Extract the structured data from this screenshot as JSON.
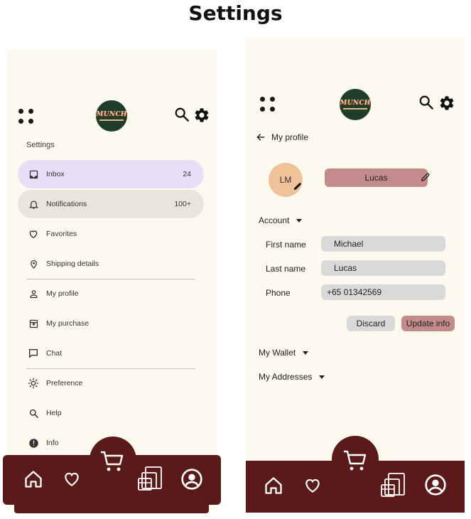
{
  "page_title": "Settings",
  "left": {
    "menu_heading": "Settings",
    "menu": [
      {
        "id": "inbox",
        "label": "Inbox",
        "badge": "24",
        "icon": "inbox-icon"
      },
      {
        "id": "notifications",
        "label": "Notifications",
        "badge": "100+",
        "icon": "bell-icon"
      },
      {
        "id": "favorites",
        "label": "Favorites",
        "badge": "",
        "icon": "heart-icon"
      },
      {
        "id": "shipping",
        "label": "Shipping details",
        "badge": "",
        "icon": "location-pin-icon"
      },
      {
        "id": "profile",
        "label": "My profile",
        "badge": "",
        "icon": "person-icon"
      },
      {
        "id": "purchase",
        "label": "My purchase",
        "badge": "",
        "icon": "download-box-icon"
      },
      {
        "id": "chat",
        "label": "Chat",
        "badge": "",
        "icon": "chat-icon"
      },
      {
        "id": "preference",
        "label": "Preference",
        "badge": "",
        "icon": "sun-icon"
      },
      {
        "id": "help",
        "label": "Help",
        "badge": "",
        "icon": "search-icon"
      },
      {
        "id": "info",
        "label": "Info",
        "badge": "",
        "icon": "info-icon"
      }
    ]
  },
  "brand": {
    "logo_text": "MUNCH"
  },
  "right": {
    "back_label": "My profile",
    "avatar_initials": "LM",
    "display_name": "Lucas",
    "account_label": "Account",
    "fields": [
      {
        "label": "First name",
        "value": "Michael"
      },
      {
        "label": "Last name",
        "value": "Lucas"
      },
      {
        "label": "Phone",
        "value": "+65 01342569"
      }
    ],
    "discard_label": "Discard",
    "update_label": "Update info",
    "wallet_label": "My Wallet",
    "addresses_label": "My Addresses"
  },
  "colors": {
    "panel_bg": "#fcf9ee",
    "nav_bg": "#5a1a1a",
    "active_item": "#e8def8",
    "accent_pill": "#c48b8c",
    "avatar_bg": "#efc29a",
    "logo_bg": "#1f3d27"
  }
}
